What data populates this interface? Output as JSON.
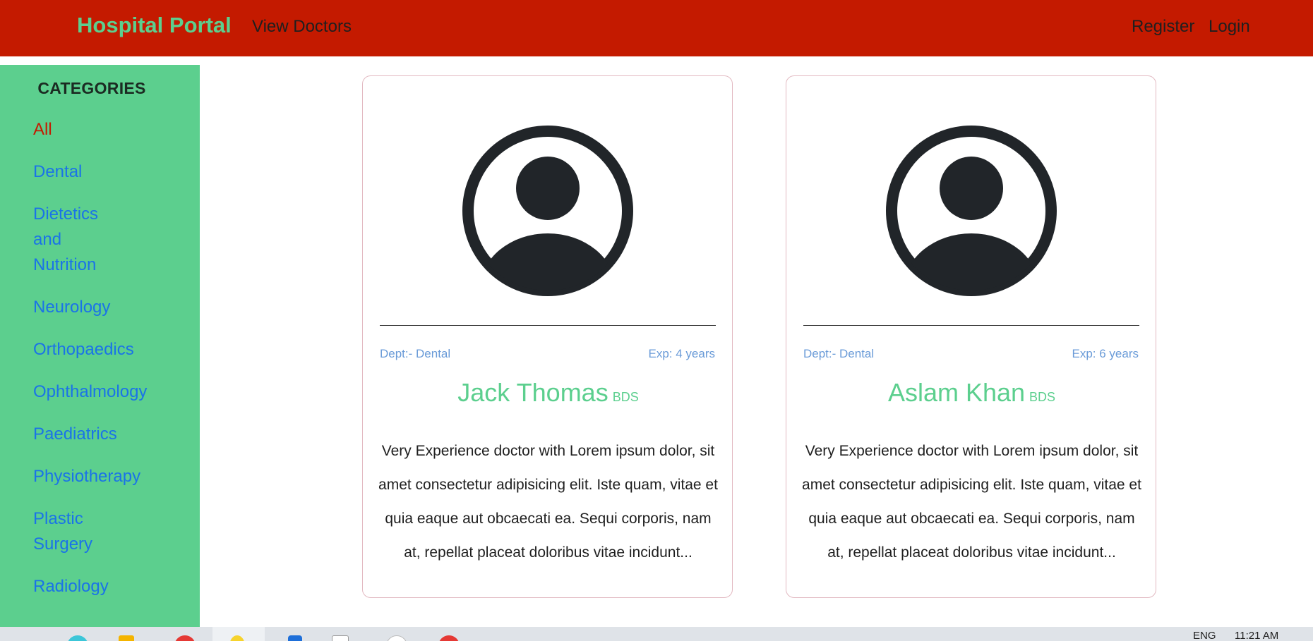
{
  "navbar": {
    "brand": "Hospital Portal",
    "view_doctors": "View Doctors",
    "register": "Register",
    "login": "Login"
  },
  "sidebar": {
    "title": "CATEGORIES",
    "items": [
      {
        "label": "All",
        "active": true
      },
      {
        "label": "Dental"
      },
      {
        "label": "Dietetics\nand\nNutrition"
      },
      {
        "label": "Neurology"
      },
      {
        "label": "Orthopaedics"
      },
      {
        "label": "Ophthalmology"
      },
      {
        "label": "Paediatrics"
      },
      {
        "label": "Physiotherapy"
      },
      {
        "label": "Plastic\nSurgery"
      },
      {
        "label": "Radiology"
      }
    ]
  },
  "doctors": [
    {
      "dept": "Dept:- Dental",
      "exp": "Exp: 4 years",
      "name": "Jack Thomas",
      "degree": "BDS",
      "description": "Very Experience doctor with Lorem ipsum dolor, sit amet consectetur adipisicing elit. Iste quam, vitae et quia eaque aut obcaecati ea. Sequi corporis, nam at, repellat placeat doloribus vitae incidunt..."
    },
    {
      "dept": "Dept:- Dental",
      "exp": "Exp: 6 years",
      "name": "Aslam Khan",
      "degree": "BDS",
      "description": "Very Experience doctor with Lorem ipsum dolor, sit amet consectetur adipisicing elit. Iste quam, vitae et quia eaque aut obcaecati ea. Sequi corporis, nam at, repellat placeat doloribus vitae incidunt..."
    }
  ],
  "taskbar": {
    "language": "ENG",
    "time": "11:21 AM"
  },
  "colors": {
    "navbar_bg": "#c41a00",
    "brand": "#5ccf8e",
    "sidebar_bg": "#5ccf8e",
    "link": "#1a73e8",
    "active_link": "#c41a00",
    "card_meta": "#6a9bd8",
    "avatar": "#212529"
  }
}
